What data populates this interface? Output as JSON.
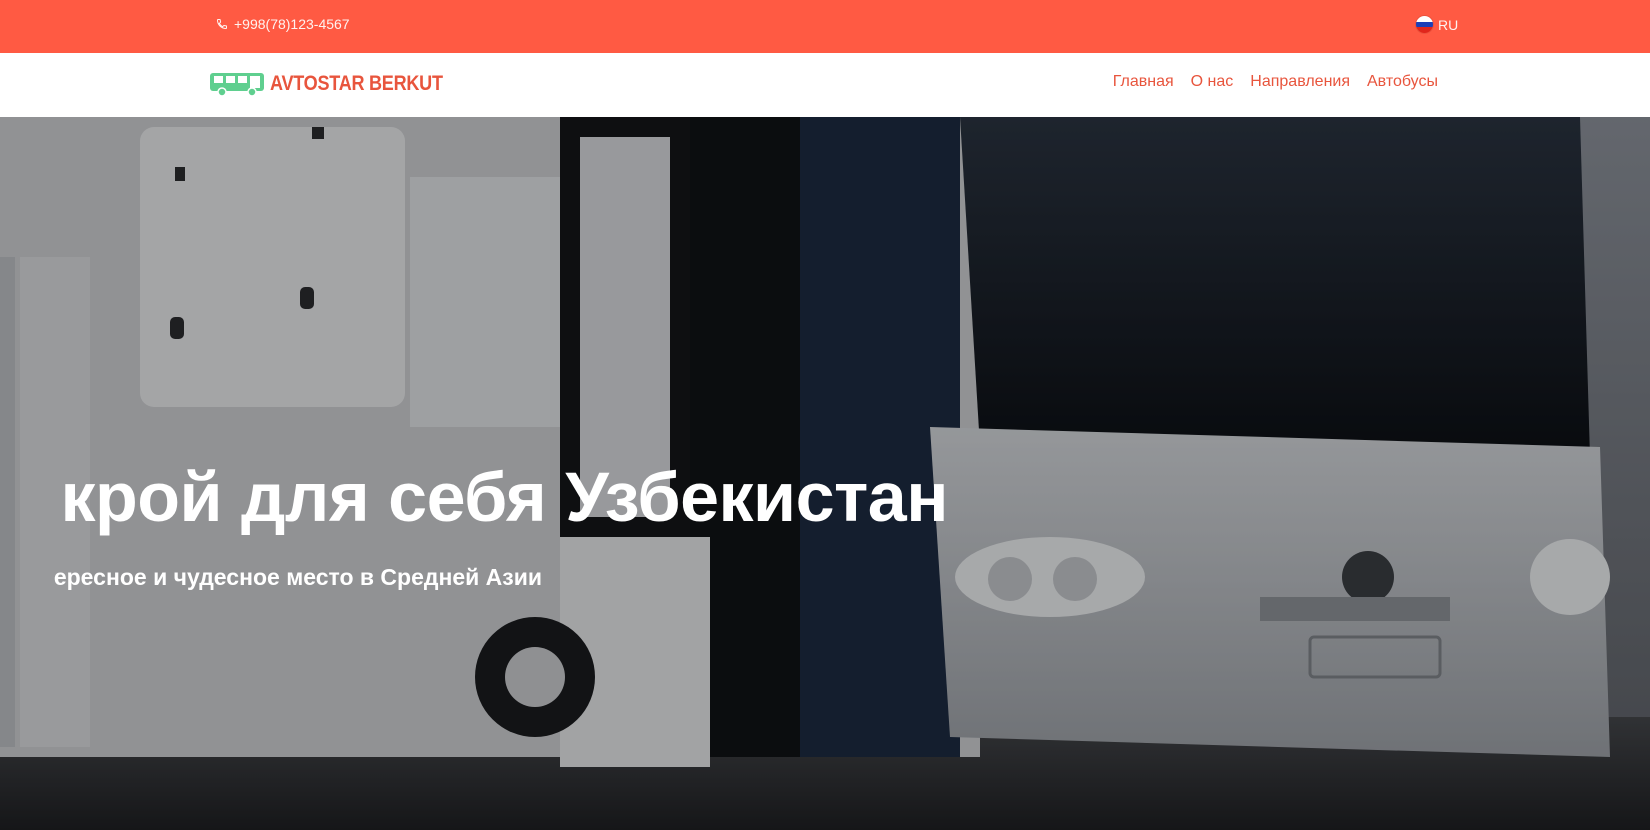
{
  "topbar": {
    "phone": "+998(78)123-4567",
    "language": "RU",
    "background_color": "#ff5a43"
  },
  "header": {
    "logo_text": "AVTOSTAR BERKUT",
    "logo_icon": "bus-icon",
    "nav_items": [
      {
        "label": "Главная"
      },
      {
        "label": "О нас"
      },
      {
        "label": "Направления"
      },
      {
        "label": "Автобусы"
      }
    ],
    "accent_color": "#e8553d"
  },
  "hero": {
    "title": "крой для себя Узбекистан",
    "subtitle": "ересное и чудесное место в Средней Азии"
  }
}
